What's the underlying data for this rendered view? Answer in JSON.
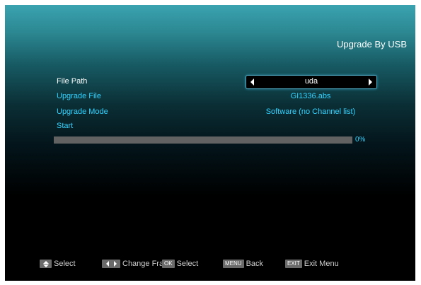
{
  "window": {
    "title": "Upgrade By USB"
  },
  "form": {
    "file_path": {
      "label": "File Path",
      "value": "uda"
    },
    "upgrade_file": {
      "label": "Upgrade File",
      "value": "GI1336.abs"
    },
    "upgrade_mode": {
      "label": "Upgrade Mode",
      "value": "Software (no Channel list)"
    },
    "start": {
      "label": "Start"
    }
  },
  "progress": {
    "percent_text": "0%",
    "fraction": 0.0,
    "fill_color": "#33d3ff",
    "track_color": "#626262"
  },
  "footer": {
    "select": {
      "icon": "up-down-arrows-icon",
      "label": "Select"
    },
    "change_frame": {
      "icon": "left-right-arrows-icon",
      "label": "Change Fram"
    },
    "ok": {
      "key": "OK",
      "label": "Select"
    },
    "menu": {
      "key": "MENU",
      "label": "Back"
    },
    "exit": {
      "key": "EXIT",
      "label": "Exit Menu"
    }
  },
  "colors": {
    "accent": "#33d3ff",
    "text": "#ffffff",
    "background_top": "#3aa3b0",
    "background_bottom": "#000000"
  }
}
